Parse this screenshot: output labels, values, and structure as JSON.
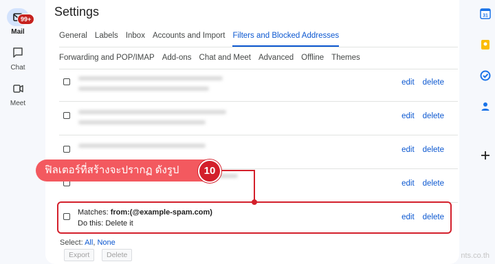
{
  "left_rail": {
    "items": [
      {
        "label": "Mail",
        "icon": "mail-icon",
        "badge": "99+",
        "active": true
      },
      {
        "label": "Chat",
        "icon": "chat-icon"
      },
      {
        "label": "Meet",
        "icon": "video-icon"
      }
    ]
  },
  "settings": {
    "title": "Settings",
    "tabs_row1": [
      "General",
      "Labels",
      "Inbox",
      "Accounts and Import",
      "Filters and Blocked Addresses"
    ],
    "tabs_row2": [
      "Forwarding and POP/IMAP",
      "Add-ons",
      "Chat and Meet",
      "Advanced",
      "Offline",
      "Themes"
    ],
    "active_tab": "Filters and Blocked Addresses",
    "row_links": {
      "edit": "edit",
      "delete": "delete"
    },
    "new_filter": {
      "matches_label": "Matches:",
      "matches_value": "from:(@example-spam.com)",
      "action": "Do this: Delete it"
    },
    "select": {
      "label": "Select:",
      "all": "All",
      "sep": ",",
      "none": "None"
    },
    "buttons": {
      "export": "Export",
      "delete": "Delete"
    }
  },
  "callout": {
    "text": "ฟิลเตอร์ที่สร้างจะปรากฏ ดังรูป",
    "step": "10"
  },
  "right_rail": [
    "calendar-icon",
    "keep-icon",
    "tasks-icon",
    "contacts-icon",
    "plus-icon"
  ],
  "watermark": "nts.co.th",
  "colors": {
    "accent": "#0b57d0",
    "callout": "#f3595f",
    "highlight": "#d31f2b",
    "badge": "#c5221f"
  }
}
